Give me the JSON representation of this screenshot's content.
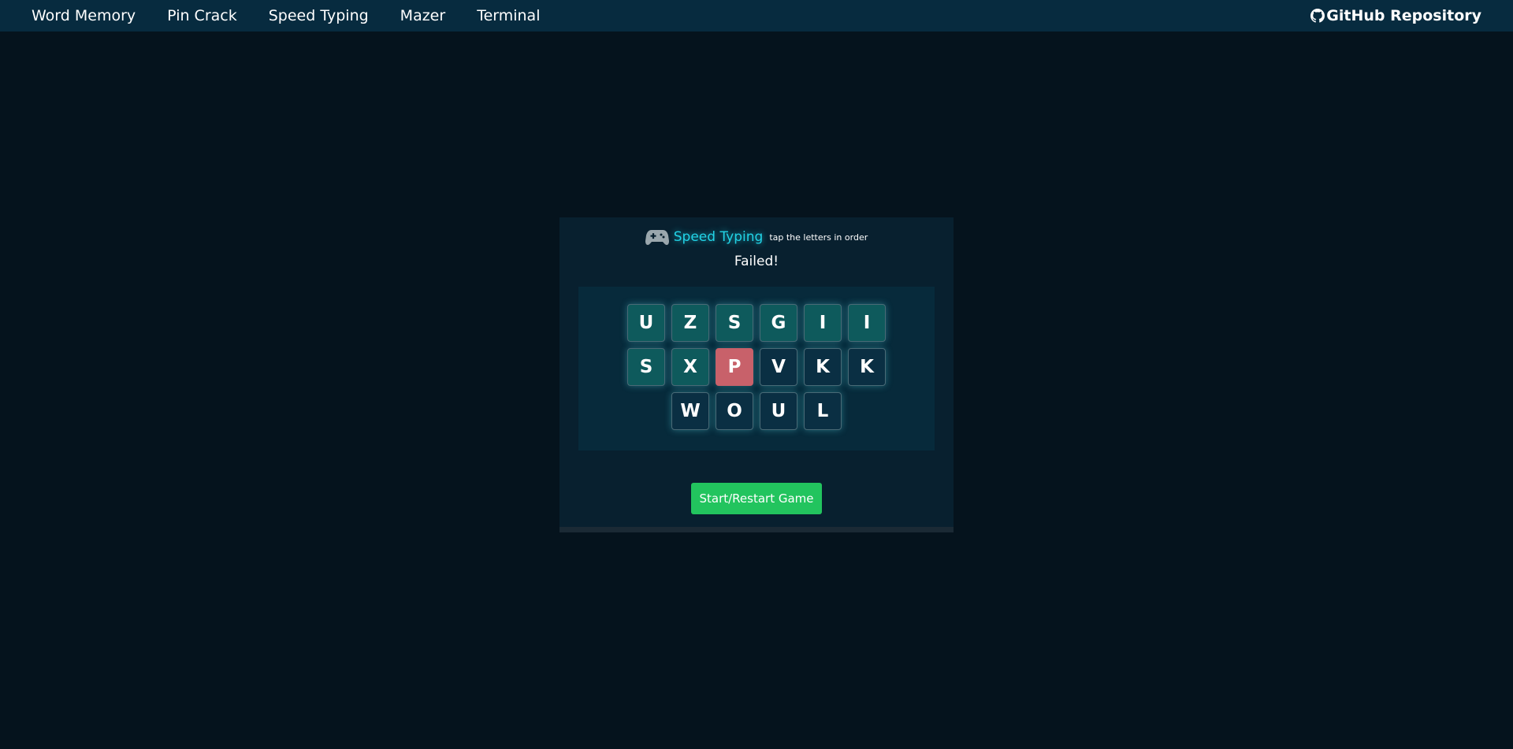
{
  "nav": {
    "links": [
      "Word Memory",
      "Pin Crack",
      "Speed Typing",
      "Mazer",
      "Terminal"
    ],
    "github_label": "GitHub Repository"
  },
  "game": {
    "icon": "gamepad-icon",
    "title": "Speed Typing",
    "subtitle": "tap the letters in order",
    "status": "Failed!",
    "tiles": [
      {
        "letter": "U",
        "state": "done"
      },
      {
        "letter": "Z",
        "state": "done"
      },
      {
        "letter": "S",
        "state": "done"
      },
      {
        "letter": "G",
        "state": "done"
      },
      {
        "letter": "I",
        "state": "done"
      },
      {
        "letter": "I",
        "state": "done"
      },
      {
        "letter": "S",
        "state": "done"
      },
      {
        "letter": "X",
        "state": "done"
      },
      {
        "letter": "P",
        "state": "failed"
      },
      {
        "letter": "V",
        "state": "pending"
      },
      {
        "letter": "K",
        "state": "pending"
      },
      {
        "letter": "K",
        "state": "pending"
      },
      {
        "letter": "W",
        "state": "pending"
      },
      {
        "letter": "O",
        "state": "pending"
      },
      {
        "letter": "U",
        "state": "pending"
      },
      {
        "letter": "L",
        "state": "pending"
      }
    ],
    "button_label": "Start/Restart Game"
  },
  "colors": {
    "page_bg": "#05131d",
    "nav_bg": "#072b3f",
    "accent": "#22d3e6",
    "tile_done": "#0e5a5c",
    "tile_failed": "#c8616a",
    "tile_pending": "#0a2f43",
    "button": "#22c45e"
  }
}
